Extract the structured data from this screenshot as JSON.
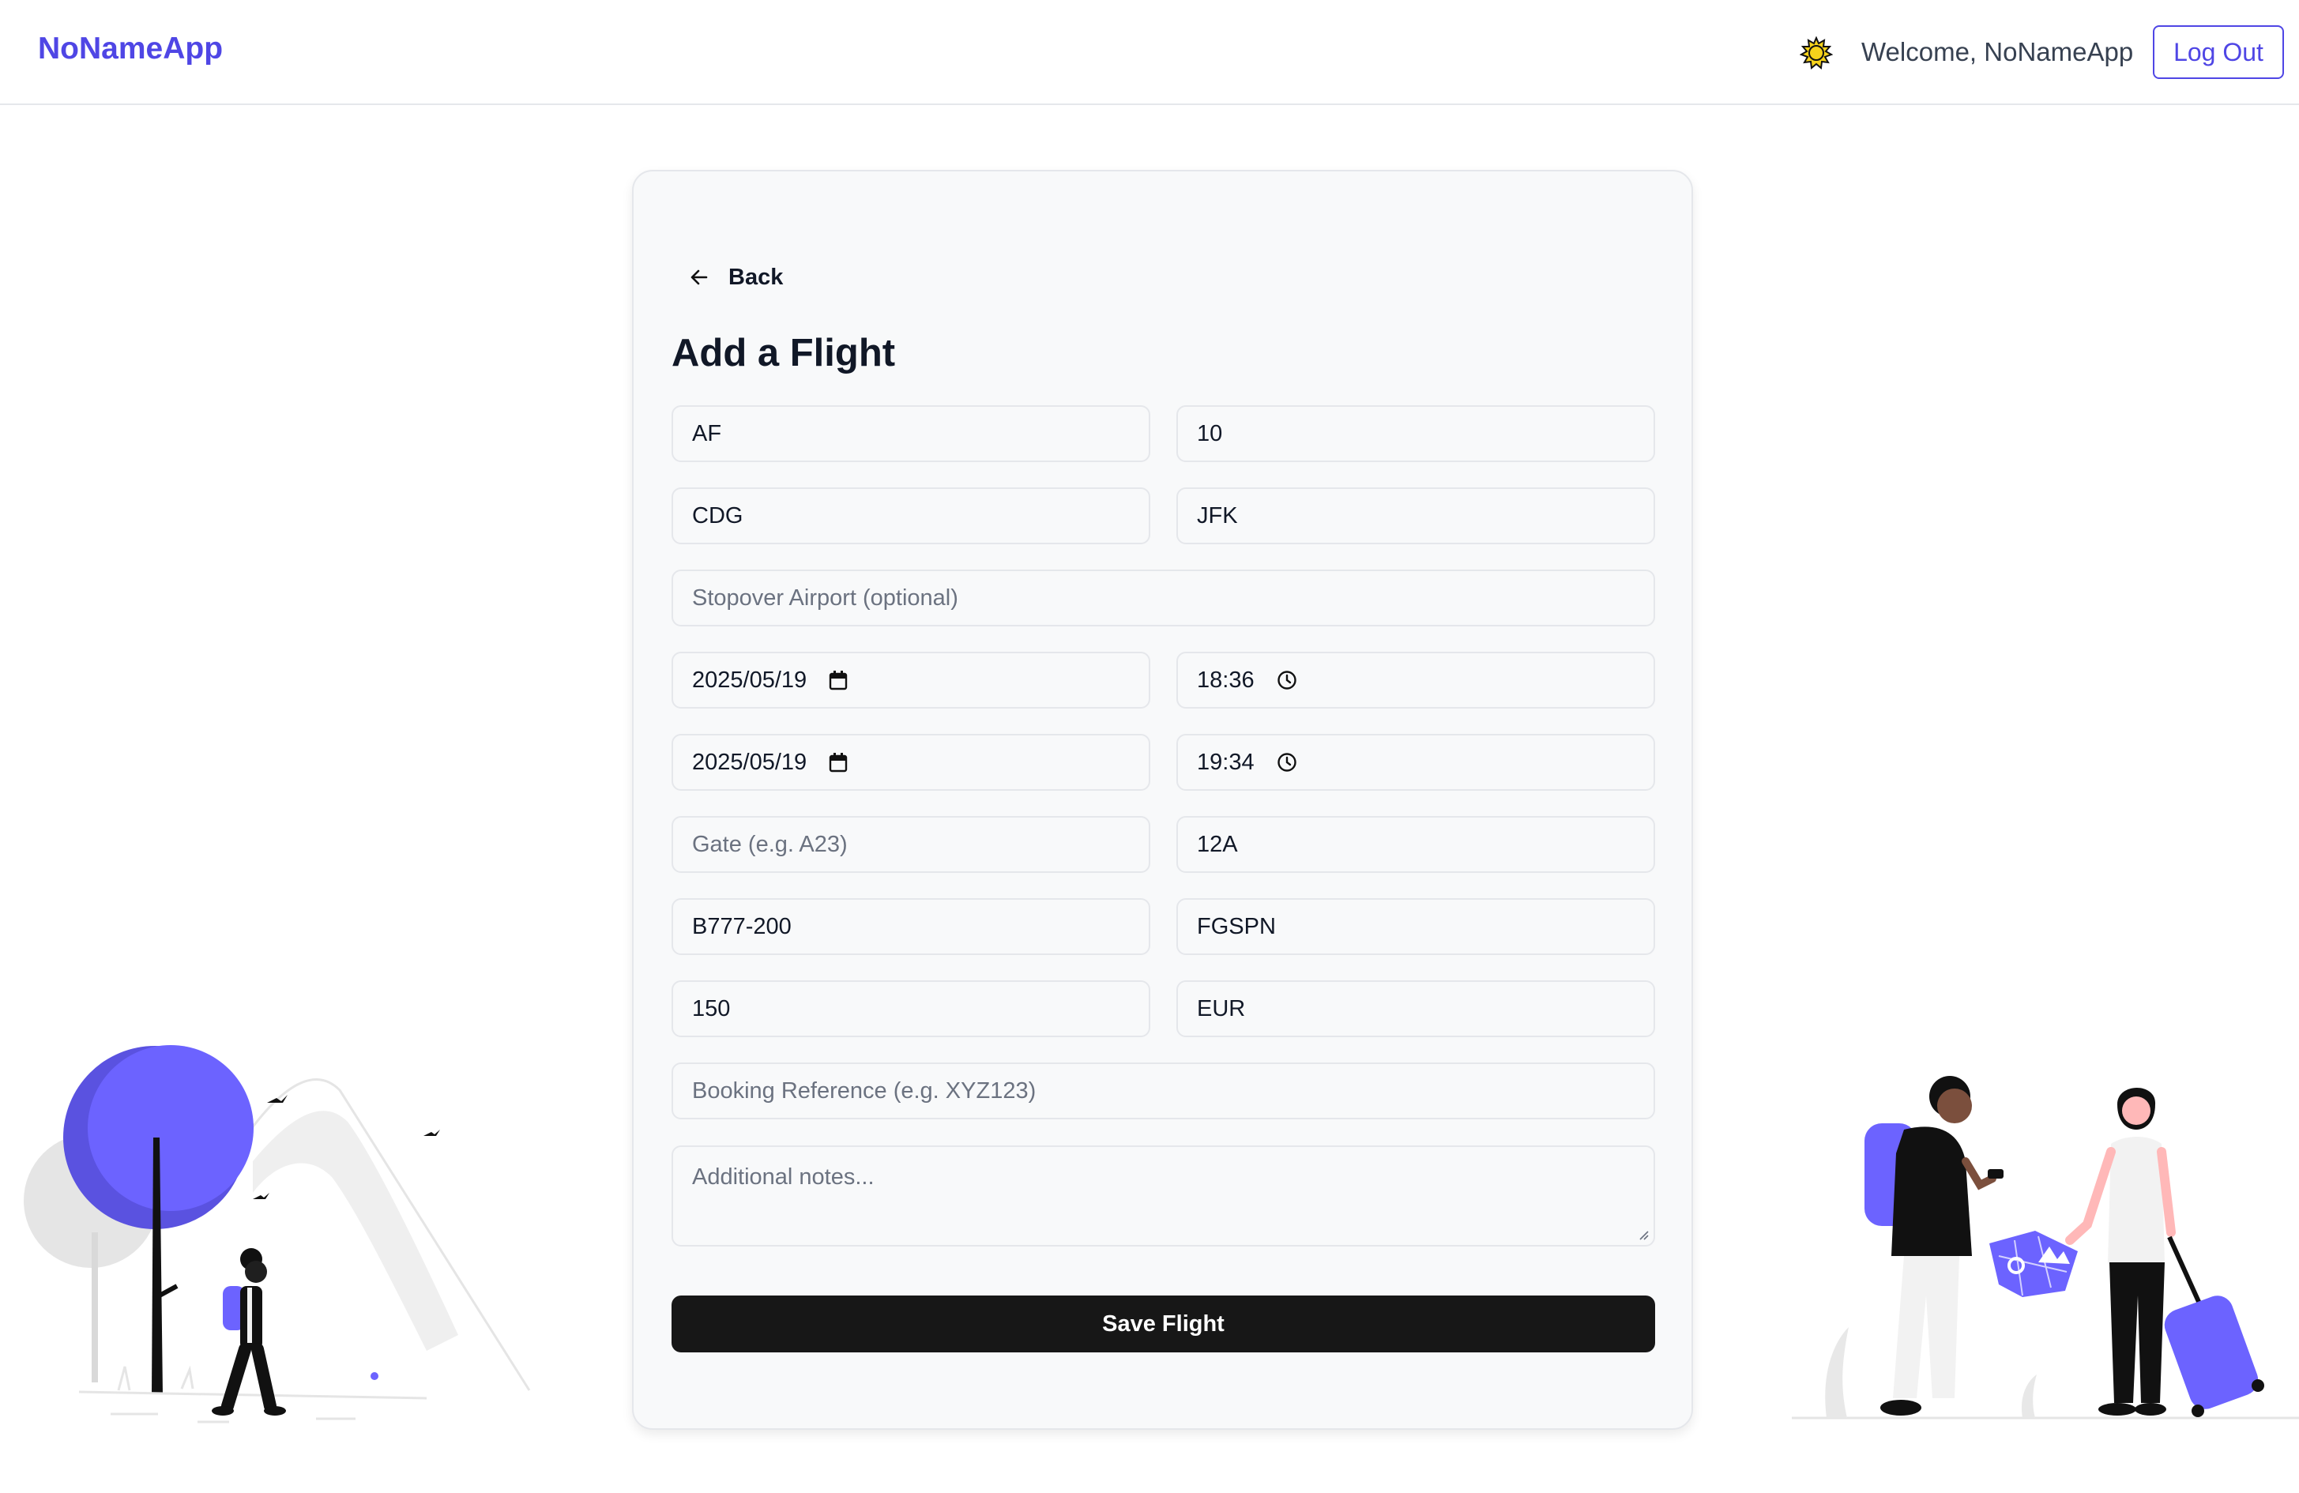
{
  "header": {
    "brand": "NoNameApp",
    "theme_icon": "sun-icon",
    "welcome": "Welcome, NoNameApp",
    "logout_label": "Log Out"
  },
  "form": {
    "back_label": "Back",
    "title": "Add a Flight",
    "airline": "AF",
    "flight_number": "10",
    "departure_airport": "CDG",
    "arrival_airport": "JFK",
    "stopover_placeholder": "Stopover Airport (optional)",
    "departure_date": "2025/05/19",
    "departure_time": "18:36",
    "arrival_date": "2025/05/19",
    "arrival_time": "19:34",
    "gate_placeholder": "Gate (e.g. A23)",
    "seat": "12A",
    "aircraft_type": "B777-200",
    "aircraft_registration": "FGSPN",
    "price": "150",
    "currency": "EUR",
    "booking_placeholder": "Booking Reference (e.g. XYZ123)",
    "notes_placeholder": "Additional notes...",
    "save_label": "Save Flight"
  },
  "colors": {
    "accent": "#4f46e5",
    "illustration_purple": "#6c63ff",
    "button_dark": "#171717"
  }
}
